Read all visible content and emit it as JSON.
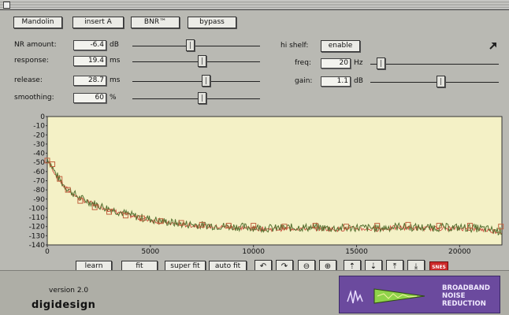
{
  "toolbar": {
    "preset": "Mandolin",
    "insert": "insert A",
    "plugin": "BNR™",
    "bypass": "bypass"
  },
  "controls": {
    "nr_amount": {
      "label": "NR amount:",
      "value": "-6.4",
      "unit": "dB",
      "level": 0.45
    },
    "response": {
      "label": "response:",
      "value": "19.4",
      "unit": "ms",
      "level": 0.55
    },
    "release": {
      "label": "release:",
      "value": "28.7",
      "unit": "ms",
      "level": 0.58
    },
    "smoothing": {
      "label": "smoothing:",
      "value": "60",
      "unit": "%",
      "level": 0.55
    },
    "hi_shelf": {
      "label": "hi shelf:",
      "value": "enable"
    },
    "freq": {
      "label": "freq:",
      "value": "20",
      "unit": "Hz",
      "level": 0.05
    },
    "gain": {
      "label": "gain:",
      "value": "1.1",
      "unit": "dB",
      "level": 0.55
    }
  },
  "chart_data": {
    "type": "line",
    "y_ticks": [
      "0",
      "-10",
      "-20",
      "-30",
      "-40",
      "-50",
      "-60",
      "-70",
      "-80",
      "-90",
      "-100",
      "-110",
      "-120",
      "-130",
      "-140"
    ],
    "x_ticks": [
      "0",
      "5000",
      "10000",
      "15000",
      "20000"
    ],
    "xlim": [
      0,
      22050
    ],
    "ylim": [
      -140,
      0
    ],
    "grid": false,
    "colors": {
      "background": "#f4f1c6",
      "signal": "#557030",
      "noise": "#c84032",
      "markers": "#c0623f"
    },
    "series": [
      {
        "x": [
          0,
          400,
          800,
          1500,
          2500,
          3500,
          4500,
          5500,
          6500,
          8000,
          9000,
          10000,
          11000,
          12000,
          13000,
          14000,
          15000,
          16000,
          17000,
          18000,
          19000,
          20000,
          21000,
          22000
        ],
        "values": [
          -45,
          -62,
          -75,
          -88,
          -97,
          -104,
          -110,
          -114,
          -117,
          -119,
          -120,
          -121,
          -122,
          -121,
          -121,
          -122,
          -121,
          -122,
          -120,
          -121,
          -121,
          -121,
          -122,
          -125
        ]
      }
    ],
    "markers": {
      "x": [
        0,
        250,
        600,
        1000,
        1600,
        2300,
        3000,
        3800,
        4600,
        5500,
        6500,
        7500,
        8800,
        10000,
        11500,
        13000,
        14500,
        16000,
        17500,
        19000,
        20500,
        22000
      ],
      "values": [
        -48,
        -52,
        -68,
        -80,
        -92,
        -99,
        -104,
        -108,
        -111,
        -114,
        -116,
        -118,
        -119,
        -119,
        -120,
        -119,
        -120,
        -119,
        -118,
        -119,
        -119,
        -120
      ]
    }
  },
  "tools": {
    "learn": "learn",
    "fit": "fit",
    "super_fit": "super fit",
    "auto_fit": "auto fit",
    "undo_icon": "↶",
    "redo_icon": "↷",
    "zoom_out_icon": "⊖",
    "zoom_in_icon": "⊕",
    "shift_up_icon": "⇡",
    "shift_down_icon": "⇣",
    "raise_icon": "⤒",
    "lower_icon": "⤓",
    "clear_label": "SNES"
  },
  "footer": {
    "version": "version 2.0",
    "brand": "digidesign",
    "product_line1": "BROADBAND",
    "product_line2": "NOISE",
    "product_line3": "REDUCTION"
  }
}
